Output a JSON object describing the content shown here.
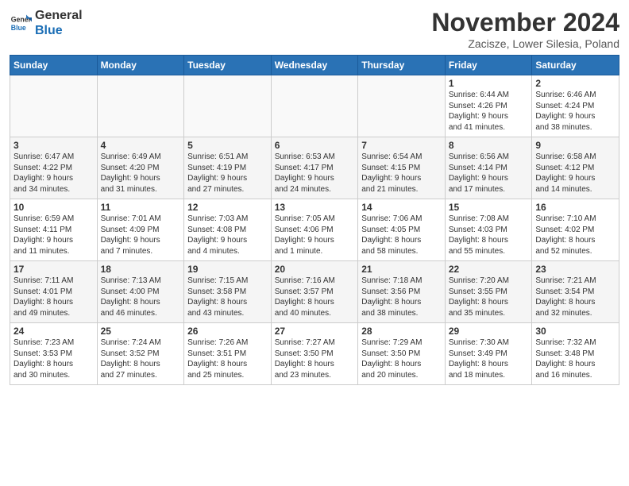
{
  "header": {
    "logo_line1": "General",
    "logo_line2": "Blue",
    "month_title": "November 2024",
    "location": "Zacisze, Lower Silesia, Poland"
  },
  "weekdays": [
    "Sunday",
    "Monday",
    "Tuesday",
    "Wednesday",
    "Thursday",
    "Friday",
    "Saturday"
  ],
  "weeks": [
    [
      {
        "day": "",
        "content": ""
      },
      {
        "day": "",
        "content": ""
      },
      {
        "day": "",
        "content": ""
      },
      {
        "day": "",
        "content": ""
      },
      {
        "day": "",
        "content": ""
      },
      {
        "day": "1",
        "content": "Sunrise: 6:44 AM\nSunset: 4:26 PM\nDaylight: 9 hours\nand 41 minutes."
      },
      {
        "day": "2",
        "content": "Sunrise: 6:46 AM\nSunset: 4:24 PM\nDaylight: 9 hours\nand 38 minutes."
      }
    ],
    [
      {
        "day": "3",
        "content": "Sunrise: 6:47 AM\nSunset: 4:22 PM\nDaylight: 9 hours\nand 34 minutes."
      },
      {
        "day": "4",
        "content": "Sunrise: 6:49 AM\nSunset: 4:20 PM\nDaylight: 9 hours\nand 31 minutes."
      },
      {
        "day": "5",
        "content": "Sunrise: 6:51 AM\nSunset: 4:19 PM\nDaylight: 9 hours\nand 27 minutes."
      },
      {
        "day": "6",
        "content": "Sunrise: 6:53 AM\nSunset: 4:17 PM\nDaylight: 9 hours\nand 24 minutes."
      },
      {
        "day": "7",
        "content": "Sunrise: 6:54 AM\nSunset: 4:15 PM\nDaylight: 9 hours\nand 21 minutes."
      },
      {
        "day": "8",
        "content": "Sunrise: 6:56 AM\nSunset: 4:14 PM\nDaylight: 9 hours\nand 17 minutes."
      },
      {
        "day": "9",
        "content": "Sunrise: 6:58 AM\nSunset: 4:12 PM\nDaylight: 9 hours\nand 14 minutes."
      }
    ],
    [
      {
        "day": "10",
        "content": "Sunrise: 6:59 AM\nSunset: 4:11 PM\nDaylight: 9 hours\nand 11 minutes."
      },
      {
        "day": "11",
        "content": "Sunrise: 7:01 AM\nSunset: 4:09 PM\nDaylight: 9 hours\nand 7 minutes."
      },
      {
        "day": "12",
        "content": "Sunrise: 7:03 AM\nSunset: 4:08 PM\nDaylight: 9 hours\nand 4 minutes."
      },
      {
        "day": "13",
        "content": "Sunrise: 7:05 AM\nSunset: 4:06 PM\nDaylight: 9 hours\nand 1 minute."
      },
      {
        "day": "14",
        "content": "Sunrise: 7:06 AM\nSunset: 4:05 PM\nDaylight: 8 hours\nand 58 minutes."
      },
      {
        "day": "15",
        "content": "Sunrise: 7:08 AM\nSunset: 4:03 PM\nDaylight: 8 hours\nand 55 minutes."
      },
      {
        "day": "16",
        "content": "Sunrise: 7:10 AM\nSunset: 4:02 PM\nDaylight: 8 hours\nand 52 minutes."
      }
    ],
    [
      {
        "day": "17",
        "content": "Sunrise: 7:11 AM\nSunset: 4:01 PM\nDaylight: 8 hours\nand 49 minutes."
      },
      {
        "day": "18",
        "content": "Sunrise: 7:13 AM\nSunset: 4:00 PM\nDaylight: 8 hours\nand 46 minutes."
      },
      {
        "day": "19",
        "content": "Sunrise: 7:15 AM\nSunset: 3:58 PM\nDaylight: 8 hours\nand 43 minutes."
      },
      {
        "day": "20",
        "content": "Sunrise: 7:16 AM\nSunset: 3:57 PM\nDaylight: 8 hours\nand 40 minutes."
      },
      {
        "day": "21",
        "content": "Sunrise: 7:18 AM\nSunset: 3:56 PM\nDaylight: 8 hours\nand 38 minutes."
      },
      {
        "day": "22",
        "content": "Sunrise: 7:20 AM\nSunset: 3:55 PM\nDaylight: 8 hours\nand 35 minutes."
      },
      {
        "day": "23",
        "content": "Sunrise: 7:21 AM\nSunset: 3:54 PM\nDaylight: 8 hours\nand 32 minutes."
      }
    ],
    [
      {
        "day": "24",
        "content": "Sunrise: 7:23 AM\nSunset: 3:53 PM\nDaylight: 8 hours\nand 30 minutes."
      },
      {
        "day": "25",
        "content": "Sunrise: 7:24 AM\nSunset: 3:52 PM\nDaylight: 8 hours\nand 27 minutes."
      },
      {
        "day": "26",
        "content": "Sunrise: 7:26 AM\nSunset: 3:51 PM\nDaylight: 8 hours\nand 25 minutes."
      },
      {
        "day": "27",
        "content": "Sunrise: 7:27 AM\nSunset: 3:50 PM\nDaylight: 8 hours\nand 23 minutes."
      },
      {
        "day": "28",
        "content": "Sunrise: 7:29 AM\nSunset: 3:50 PM\nDaylight: 8 hours\nand 20 minutes."
      },
      {
        "day": "29",
        "content": "Sunrise: 7:30 AM\nSunset: 3:49 PM\nDaylight: 8 hours\nand 18 minutes."
      },
      {
        "day": "30",
        "content": "Sunrise: 7:32 AM\nSunset: 3:48 PM\nDaylight: 8 hours\nand 16 minutes."
      }
    ]
  ]
}
